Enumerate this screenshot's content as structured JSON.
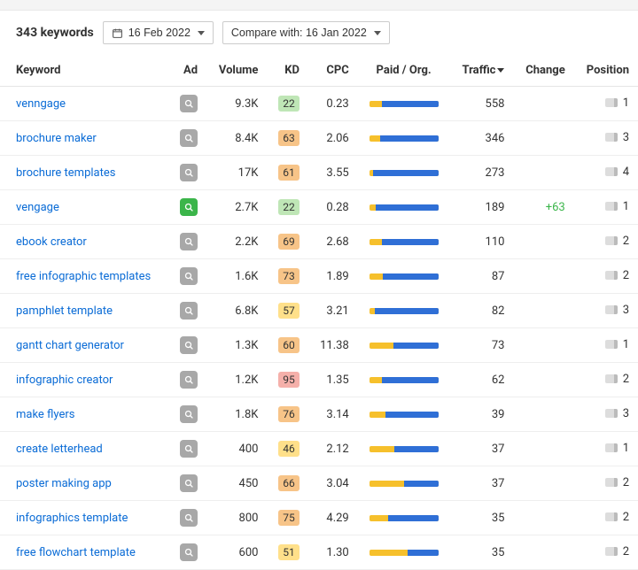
{
  "toolbar": {
    "count": "343 keywords",
    "date": "16 Feb 2022",
    "compare": "Compare with: 16 Jan 2022"
  },
  "columns": {
    "keyword": "Keyword",
    "ad": "Ad",
    "volume": "Volume",
    "kd": "KD",
    "cpc": "CPC",
    "po": "Paid / Org.",
    "traffic": "Traffic",
    "change": "Change",
    "position": "Position"
  },
  "sort": {
    "col": "traffic",
    "dir": "desc"
  },
  "chart_data": {
    "type": "table",
    "columns": [
      "Keyword",
      "Ad",
      "Volume",
      "KD",
      "CPC",
      "Paid %",
      "Organic %",
      "Traffic",
      "Change",
      "Position"
    ],
    "rows": [
      [
        "venngage",
        false,
        9300,
        22,
        0.23,
        18,
        82,
        558,
        null,
        1
      ],
      [
        "brochure maker",
        false,
        8400,
        63,
        2.06,
        16,
        84,
        346,
        null,
        3
      ],
      [
        "brochure templates",
        false,
        17000,
        61,
        3.55,
        5,
        95,
        273,
        null,
        4
      ],
      [
        "vengage",
        true,
        2700,
        22,
        0.28,
        10,
        90,
        189,
        63,
        1
      ],
      [
        "ebook creator",
        false,
        2200,
        69,
        2.68,
        18,
        82,
        110,
        null,
        2
      ],
      [
        "free infographic templates",
        false,
        1600,
        73,
        1.89,
        20,
        80,
        87,
        null,
        2
      ],
      [
        "pamphlet template",
        false,
        6800,
        57,
        3.21,
        8,
        92,
        82,
        null,
        3
      ],
      [
        "gantt chart generator",
        false,
        1300,
        60,
        11.38,
        35,
        65,
        73,
        null,
        1
      ],
      [
        "infographic creator",
        false,
        1200,
        95,
        1.35,
        18,
        82,
        62,
        null,
        2
      ],
      [
        "make flyers",
        false,
        1800,
        76,
        3.14,
        24,
        76,
        39,
        null,
        3
      ],
      [
        "create letterhead",
        false,
        400,
        46,
        2.12,
        36,
        64,
        37,
        null,
        1
      ],
      [
        "poster making app",
        false,
        450,
        66,
        3.04,
        50,
        50,
        37,
        null,
        2
      ],
      [
        "infographics template",
        false,
        800,
        75,
        4.29,
        28,
        72,
        35,
        null,
        2
      ],
      [
        "free flowchart template",
        false,
        600,
        51,
        1.3,
        55,
        45,
        35,
        null,
        2
      ]
    ]
  },
  "rows": [
    {
      "kw": "venngage",
      "ad": false,
      "vol": "9.3K",
      "kd": 22,
      "cpc": "0.23",
      "org": 82,
      "traffic": "558",
      "chg": "",
      "pos": "1"
    },
    {
      "kw": "brochure maker",
      "ad": false,
      "vol": "8.4K",
      "kd": 63,
      "cpc": "2.06",
      "org": 84,
      "traffic": "346",
      "chg": "",
      "pos": "3"
    },
    {
      "kw": "brochure templates",
      "ad": false,
      "vol": "17K",
      "kd": 61,
      "cpc": "3.55",
      "org": 95,
      "traffic": "273",
      "chg": "",
      "pos": "4"
    },
    {
      "kw": "vengage",
      "ad": true,
      "vol": "2.7K",
      "kd": 22,
      "cpc": "0.28",
      "org": 90,
      "traffic": "189",
      "chg": "+63",
      "pos": "1"
    },
    {
      "kw": "ebook creator",
      "ad": false,
      "vol": "2.2K",
      "kd": 69,
      "cpc": "2.68",
      "org": 82,
      "traffic": "110",
      "chg": "",
      "pos": "2"
    },
    {
      "kw": "free infographic templates",
      "ad": false,
      "vol": "1.6K",
      "kd": 73,
      "cpc": "1.89",
      "org": 80,
      "traffic": "87",
      "chg": "",
      "pos": "2"
    },
    {
      "kw": "pamphlet template",
      "ad": false,
      "vol": "6.8K",
      "kd": 57,
      "cpc": "3.21",
      "org": 92,
      "traffic": "82",
      "chg": "",
      "pos": "3"
    },
    {
      "kw": "gantt chart generator",
      "ad": false,
      "vol": "1.3K",
      "kd": 60,
      "cpc": "11.38",
      "org": 65,
      "traffic": "73",
      "chg": "",
      "pos": "1"
    },
    {
      "kw": "infographic creator",
      "ad": false,
      "vol": "1.2K",
      "kd": 95,
      "cpc": "1.35",
      "org": 82,
      "traffic": "62",
      "chg": "",
      "pos": "2"
    },
    {
      "kw": "make flyers",
      "ad": false,
      "vol": "1.8K",
      "kd": 76,
      "cpc": "3.14",
      "org": 76,
      "traffic": "39",
      "chg": "",
      "pos": "3"
    },
    {
      "kw": "create letterhead",
      "ad": false,
      "vol": "400",
      "kd": 46,
      "cpc": "2.12",
      "org": 64,
      "traffic": "37",
      "chg": "",
      "pos": "1"
    },
    {
      "kw": "poster making app",
      "ad": false,
      "vol": "450",
      "kd": 66,
      "cpc": "3.04",
      "org": 50,
      "traffic": "37",
      "chg": "",
      "pos": "2"
    },
    {
      "kw": "infographics template",
      "ad": false,
      "vol": "800",
      "kd": 75,
      "cpc": "4.29",
      "org": 72,
      "traffic": "35",
      "chg": "",
      "pos": "2"
    },
    {
      "kw": "free flowchart template",
      "ad": false,
      "vol": "600",
      "kd": 51,
      "cpc": "1.30",
      "org": 45,
      "traffic": "35",
      "chg": "",
      "pos": "2"
    }
  ]
}
